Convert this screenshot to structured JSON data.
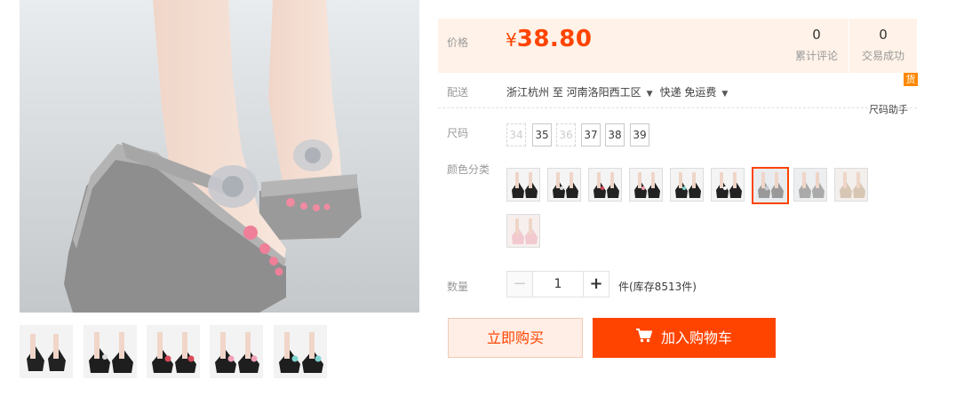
{
  "gallery": {
    "main_image": "sandal-wedge-grey-photo",
    "thumbnails": [
      "sandal-black-1",
      "sandal-black-2",
      "sandal-black-red",
      "sandal-black-pink",
      "sandal-black-white"
    ]
  },
  "price": {
    "label": "价格",
    "currency": "¥",
    "amount": "38.80",
    "reviews_count": "0",
    "reviews_label": "累计评论",
    "sales_count": "0",
    "sales_label": "交易成功"
  },
  "shipping": {
    "label": "配送",
    "from": "浙江杭州 至",
    "to": "河南洛阳西工区",
    "method": "快递 免运费",
    "huo_badge": "货",
    "size_helper": "尺码助手"
  },
  "size": {
    "label": "尺码",
    "options": [
      {
        "value": "34",
        "available": false
      },
      {
        "value": "35",
        "available": true
      },
      {
        "value": "36",
        "available": false
      },
      {
        "value": "37",
        "available": true
      },
      {
        "value": "38",
        "available": true
      },
      {
        "value": "39",
        "available": true
      }
    ]
  },
  "color": {
    "label": "颜色分类",
    "selected_index": 6,
    "swatches": [
      "color-1",
      "color-2",
      "color-3",
      "color-4",
      "color-5",
      "color-6",
      "color-7-grey",
      "color-8",
      "color-9",
      "color-10-pink"
    ]
  },
  "quantity": {
    "label": "数量",
    "minus": "−",
    "value": "1",
    "plus": "+",
    "stock": "件(库存8513件)"
  },
  "actions": {
    "buy_now": "立即购买",
    "add_to_cart": "加入购物车"
  },
  "colors": {
    "accent": "#ff4400",
    "price_bg": "#fff2e8",
    "buy_bg": "#ffeee5"
  }
}
